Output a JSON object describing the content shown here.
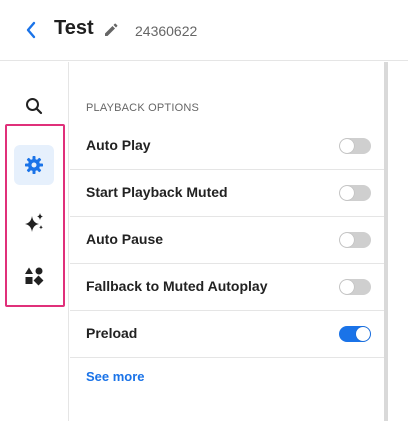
{
  "header": {
    "title": "Test",
    "id": "24360622",
    "back_icon": "chevron-left-icon",
    "edit_icon": "pencil-icon"
  },
  "sidebar": {
    "items": [
      {
        "icon": "search-icon",
        "active": false
      },
      {
        "icon": "gear-icon",
        "active": true
      },
      {
        "icon": "sparkle-icon",
        "active": false
      },
      {
        "icon": "shapes-icon",
        "active": false
      }
    ],
    "highlight_color": "#e0307a"
  },
  "panel": {
    "section_title": "PLAYBACK OPTIONS",
    "options": [
      {
        "label": "Auto Play",
        "enabled": false
      },
      {
        "label": "Start Playback Muted",
        "enabled": false
      },
      {
        "label": "Auto Pause",
        "enabled": false
      },
      {
        "label": "Fallback to Muted Autoplay",
        "enabled": false
      },
      {
        "label": "Preload",
        "enabled": true
      }
    ],
    "see_more": "See more"
  },
  "colors": {
    "accent": "#1a73e8",
    "toggle_off": "#cfcfcf",
    "active_bg": "#e6f0fc"
  }
}
